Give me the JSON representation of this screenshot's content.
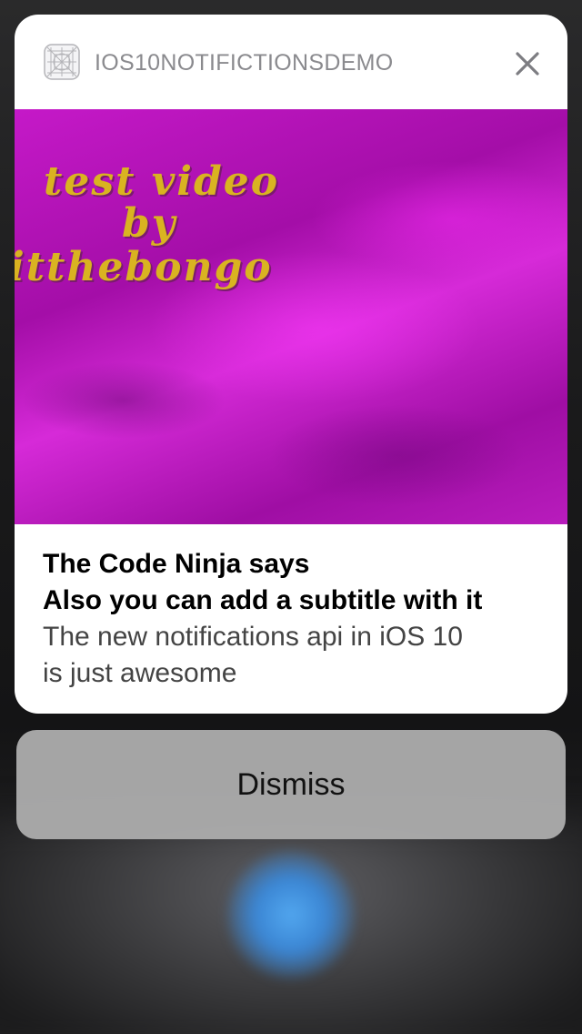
{
  "notification": {
    "app_name": "IOS10NOTIFICTIONSDEMO",
    "app_icon": "app-grid-icon",
    "close_icon": "close-icon",
    "media": {
      "caption_lines": [
        "test video",
        "by",
        "itthebongo"
      ],
      "color": "#c21bc6"
    },
    "title": "The Code Ninja says",
    "subtitle": "Also you can add a subtitle with it",
    "message_lines": [
      "The new notifications api in iOS 10",
      "is just awesome"
    ]
  },
  "actions": {
    "dismiss_label": "Dismiss"
  }
}
